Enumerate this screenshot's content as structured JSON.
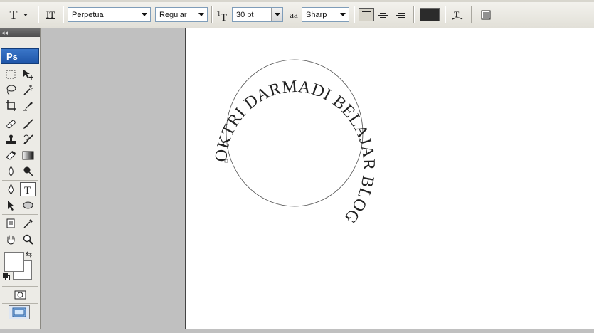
{
  "options_bar": {
    "tool_glyph": "T",
    "orient_glyph": "IT",
    "font_family": "Perpetua",
    "font_style": "Regular",
    "font_size": "30 pt",
    "aa_glyph": "aa",
    "antialias": "Sharp",
    "text_color": "#2b2b2b"
  },
  "toolbox": {
    "collapse_glyph": "◂◂",
    "logo": "Ps",
    "foreground_color": "#ffffff",
    "background_color": "#ffffff"
  },
  "document": {
    "path_text": "OKTRI DARMADI BELAJAR BLOG"
  }
}
